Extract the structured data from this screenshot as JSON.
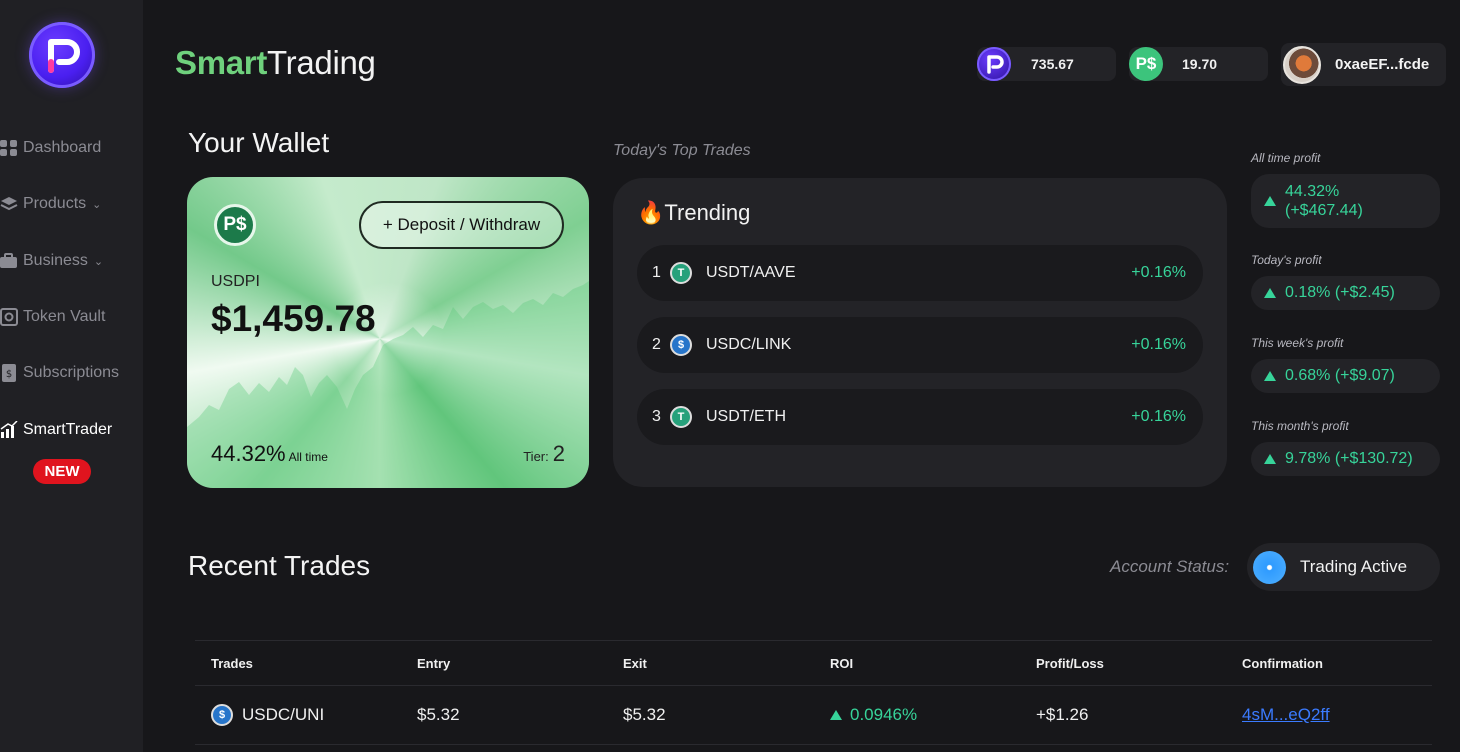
{
  "sidebar": {
    "items": [
      {
        "label": "Dashboard",
        "icon": "grid-icon"
      },
      {
        "label": "Products",
        "icon": "layers-icon"
      },
      {
        "label": "Business",
        "icon": "briefcase-icon"
      },
      {
        "label": "Token Vault",
        "icon": "vault-icon"
      },
      {
        "label": "Subscriptions",
        "icon": "receipt-icon"
      },
      {
        "label": "SmartTrader",
        "icon": "chart-icon"
      }
    ],
    "new_badge": "NEW"
  },
  "header": {
    "brand_smart": "Smart",
    "brand_trading": "Trading",
    "p_balance": "735.67",
    "ps_symbol": "P$",
    "ps_balance": "19.70",
    "wallet_address": "0xaeEF...fcde"
  },
  "wallet": {
    "title": "Your Wallet",
    "coin_symbol": "P$",
    "deposit_label": "+ Deposit / Withdraw",
    "currency": "USDPI",
    "balance": "$1,459.78",
    "all_time_pct": "44.32%",
    "all_time_label": "All time",
    "tier_label": "Tier:",
    "tier_value": "2"
  },
  "trending": {
    "section_label": "Today's Top Trades",
    "title": "🔥Trending",
    "rows": [
      {
        "rank": "1",
        "pair": "USDT/AAVE",
        "change": "+0.16%",
        "token": "USDT"
      },
      {
        "rank": "2",
        "pair": "USDC/LINK",
        "change": "+0.16%",
        "token": "USDC"
      },
      {
        "rank": "3",
        "pair": "USDT/ETH",
        "change": "+0.16%",
        "token": "USDT"
      }
    ]
  },
  "profits": [
    {
      "label": "All time profit",
      "value_line1": "44.32%",
      "value_line2": "(+$467.44)"
    },
    {
      "label": "Today's profit",
      "value": "0.18% (+$2.45)"
    },
    {
      "label": "This week's profit",
      "value": "0.68% (+$9.07)"
    },
    {
      "label": "This month's profit",
      "value": "9.78% (+$130.72)"
    }
  ],
  "recent": {
    "title": "Recent Trades",
    "account_status_label": "Account Status:",
    "account_status": "Trading Active",
    "columns": [
      "Trades",
      "Entry",
      "Exit",
      "ROI",
      "Profit/Loss",
      "Confirmation"
    ],
    "rows": [
      {
        "pair": "USDC/UNI",
        "entry": "$5.32",
        "exit": "$5.32",
        "roi": "0.0946%",
        "pl": "+$1.26",
        "confirmation": "4sM...eQ2ff"
      }
    ]
  },
  "colors": {
    "accent_green": "#37d49a",
    "brand_green": "#6fd17d",
    "badge_red": "#e0141e",
    "link_blue": "#3b7bff"
  }
}
